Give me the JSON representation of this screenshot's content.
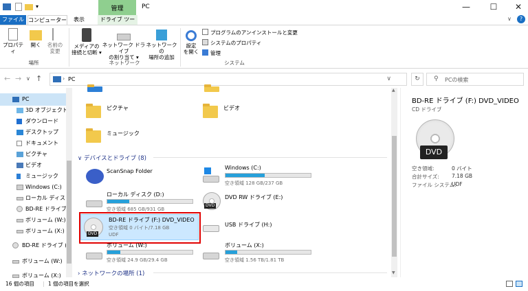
{
  "window": {
    "title": "PC",
    "manage_tab": "管理",
    "controls": {
      "minimize": "—",
      "maximize": "☐",
      "close": "✕"
    }
  },
  "tabs": {
    "file": "ファイル",
    "computer": "コンピューター",
    "view": "表示",
    "drive_tools": "ドライブ ツール"
  },
  "ribbon": {
    "location": {
      "group": "場所",
      "properties": "プロパティ",
      "open": "開く",
      "rename_line1": "名前の",
      "rename_line2": "変更"
    },
    "network": {
      "group": "ネットワーク",
      "media_line1": "メディアの",
      "media_line2": "接続と切断 ▾",
      "map_line1": "ネットワーク ドライブ",
      "map_line2": "の割り当て ▾",
      "add_line1": "ネットワークの",
      "add_line2": "場所の追加"
    },
    "system": {
      "group": "システム",
      "settings_line1": "設定",
      "settings_line2": "を開く",
      "uninstall": "プログラムのアンインストールと変更",
      "sysprops": "システムのプロパティ",
      "manage": "管理"
    }
  },
  "address": {
    "path": "PC",
    "search_placeholder": "PCの検索"
  },
  "nav": {
    "items": [
      {
        "label": "PC",
        "icon": "computer-icon"
      },
      {
        "label": "3D オブジェクト",
        "icon": "3d-objects-icon"
      },
      {
        "label": "ダウンロード",
        "icon": "download-icon"
      },
      {
        "label": "デスクトップ",
        "icon": "desktop-icon"
      },
      {
        "label": "ドキュメント",
        "icon": "document-icon"
      },
      {
        "label": "ピクチャ",
        "icon": "pictures-icon"
      },
      {
        "label": "ビデオ",
        "icon": "video-icon"
      },
      {
        "label": "ミュージック",
        "icon": "music-icon"
      },
      {
        "label": "Windows (C:)",
        "icon": "windows-drive-icon"
      },
      {
        "label": "ローカル ディスク (D",
        "icon": "drive-icon"
      },
      {
        "label": "BD-RE ドライブ (F:",
        "icon": "disc-icon"
      },
      {
        "label": "ボリューム (W:)",
        "icon": "drive-icon"
      },
      {
        "label": "ボリューム (X:)",
        "icon": "drive-icon"
      },
      {
        "label": "BD-RE ドライブ (F:)",
        "icon": "disc-icon"
      },
      {
        "label": "ボリューム (W:)",
        "icon": "drive-icon"
      },
      {
        "label": "ボリューム (X:)",
        "icon": "drive-icon"
      }
    ]
  },
  "content": {
    "folders": [
      {
        "label": "ピクチャ"
      },
      {
        "label": "ビデオ"
      },
      {
        "label": "ミュージック"
      }
    ],
    "devices_header": "デバイスとドライブ (8)",
    "network_header": "ネットワークの場所 (1)",
    "drives": {
      "scansnap": {
        "name": "ScanSnap Folder"
      },
      "windows_c": {
        "name": "Windows (C:)",
        "usage": "空き領域 128 GB/237 GB",
        "used_fraction": 0.46
      },
      "local_d": {
        "name": "ローカル ディスク (D:)",
        "usage": "空き領域 685 GB/931 GB",
        "used_fraction": 0.26
      },
      "dvdrw_e": {
        "name": "DVD RW ドライブ (E:)",
        "tag": "DVD"
      },
      "bdre_f": {
        "name": "BD-RE ドライブ (F:) DVD_VIDEO",
        "usage": "空き領域 0 バイト/7.18 GB",
        "fs": "UDF",
        "tag": "DVD"
      },
      "usb_h": {
        "name": "USB ドライブ (H:)"
      },
      "vol_w": {
        "name": "ボリューム (W:)",
        "usage": "空き領域 24.9 GB/29.4 GB",
        "used_fraction": 0.15
      },
      "vol_x": {
        "name": "ボリューム (X:)",
        "usage": "空き領域 1.56 TB/1.81 TB",
        "used_fraction": 0.14
      }
    }
  },
  "preview": {
    "title": "BD-RE ドライブ (F:) DVD_VIDEO",
    "type": "CD ドライブ",
    "badge": "DVD",
    "rows": [
      {
        "label": "空き領域:",
        "value": "0 バイト"
      },
      {
        "label": "合計サイズ:",
        "value": "7.18 GB"
      },
      {
        "label": "ファイル システム:",
        "value": "UDF"
      }
    ]
  },
  "status": {
    "count": "16 個の項目",
    "selected": "1 個の項目を選択"
  },
  "colors": {
    "accent": "#1a6fc4",
    "selection": "#cce8ff",
    "highlight_box": "#e00000",
    "bar_fill": "#26a0da"
  }
}
